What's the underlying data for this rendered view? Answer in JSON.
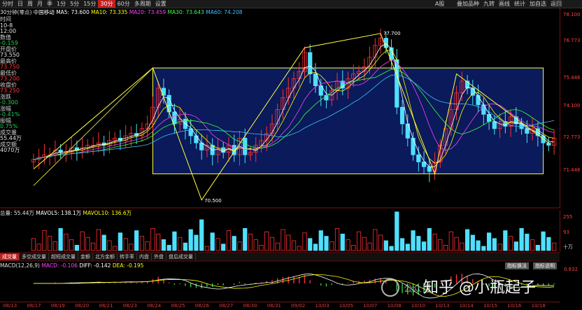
{
  "toolbar": {
    "items": [
      "分时",
      "日",
      "周",
      "月",
      "季",
      "1分",
      "5分",
      "15分",
      "30分",
      "60分",
      "多周期",
      "设置"
    ],
    "active_index": 8,
    "right_a": "A股",
    "right_items": [
      "叠加品种",
      "九转",
      "画线",
      "统计",
      "加自选",
      "返回"
    ]
  },
  "legend": {
    "title": "30分钟(零点)",
    "stock": "中国移动",
    "ma5": "MA5: 73.600",
    "ma10": "MA10: 73.335",
    "ma20": "MA20: 73.459",
    "ma30": "MA30: 73.643",
    "ma60": "MA60: 74.208",
    "colors": {
      "ma5": "#ffffff",
      "ma10": "#ffff00",
      "ma20": "#ff40ff",
      "ma30": "#40ff40",
      "ma60": "#40c0ff"
    }
  },
  "info": {
    "time_label": "时间",
    "date": "10-8",
    "time": "12:00",
    "num_label": "数值",
    "num_val": "-0.159",
    "open_label": "开盘价",
    "open_val": "73.550",
    "high_label": "最高价",
    "high_val": "73.750",
    "low_label": "最低价",
    "low_val": "73.200",
    "close_label": "收盘价",
    "close_val": "73.250",
    "chg_label": "涨跌",
    "chg_val": "-0.300",
    "pct_label": "涨幅",
    "pct_val": "-0.41%",
    "amp_label": "振幅",
    "amp_val": "0.75%",
    "vol_label": "成交量",
    "vol_val": "55.44万",
    "amt_label": "成交额",
    "amt_val": "4070万"
  },
  "price_axis": {
    "labels": [
      "78.100",
      "76.773",
      "75.446",
      "74.100",
      "72.773",
      "71.446"
    ]
  },
  "annotations": {
    "high": "77.700",
    "low": "70.500"
  },
  "volume": {
    "legend_total": "总量: 55.44万",
    "legend_ma5": "MAVOL5: 138.1万",
    "legend_ma10": "MAVOL10: 136.6万",
    "axis_top": "255",
    "axis_mid": "93",
    "axis_unit": "十万"
  },
  "tabs": {
    "items": [
      "成交量",
      "多空成交量",
      "超短成交量",
      "金额",
      "北方金额",
      "转手率",
      "内盘",
      "外盘",
      "盘后成交量"
    ],
    "active_index": 0
  },
  "macd": {
    "params": "MACD(12,26,9)",
    "macd": "MACD: -0.106",
    "diff": "DIFF: -0.142",
    "dea": "DEA: -0.195",
    "btn1": "指标换法",
    "btn2": "指标说明",
    "axis": "0.832"
  },
  "dates": [
    "08/13",
    "08/17",
    "08/19",
    "08/20",
    "08/21",
    "08/23",
    "08/24",
    "08/25",
    "08/26",
    "08/27",
    "08/30",
    "08/31",
    "09/02",
    "10/03",
    "10/05",
    "10/07",
    "10/08",
    "10/10",
    "10/13",
    "10/14",
    "10/15",
    "10/16",
    "10/18"
  ],
  "watermark": {
    "text": "知乎 @小瓶起子",
    "small": "公众号"
  },
  "chart_data": {
    "type": "candlestick",
    "ylim": [
      70.3,
      78.3
    ],
    "closes": [
      72.3,
      72.4,
      72.5,
      72.5,
      72.7,
      72.6,
      72.6,
      72.8,
      72.7,
      72.8,
      72.9,
      72.9,
      73.0,
      72.9,
      73.1,
      73.2,
      73.1,
      73.3,
      73.4,
      73.3,
      73.6,
      73.8,
      74.5,
      75.3,
      75.0,
      74.3,
      73.8,
      74.0,
      73.6,
      73.3,
      73.0,
      72.7,
      72.9,
      72.5,
      72.8,
      72.6,
      72.9,
      72.5,
      73.2,
      72.5,
      72.6,
      72.9,
      73.1,
      73.4,
      73.8,
      74.4,
      74.9,
      75.3,
      75.7,
      76.0,
      76.8,
      75.9,
      75.4,
      75.0,
      74.8,
      75.2,
      75.6,
      75.3,
      75.7,
      75.9,
      76.0,
      76.2,
      76.6,
      77.1,
      77.4,
      77.0,
      76.5,
      74.5,
      73.8,
      73.2,
      72.5,
      72.2,
      72.0,
      71.8,
      72.2,
      72.9,
      73.6,
      74.4,
      75.1,
      75.6,
      75.3,
      75.0,
      74.6,
      74.2,
      73.9,
      73.6,
      73.9,
      73.7,
      74.1,
      73.8,
      73.6,
      73.4,
      73.6,
      73.3,
      73.0,
      72.9,
      73.2
    ],
    "box": {
      "x_start": 22,
      "x_end": 94,
      "top": 76.15,
      "bottom": 71.7
    }
  }
}
